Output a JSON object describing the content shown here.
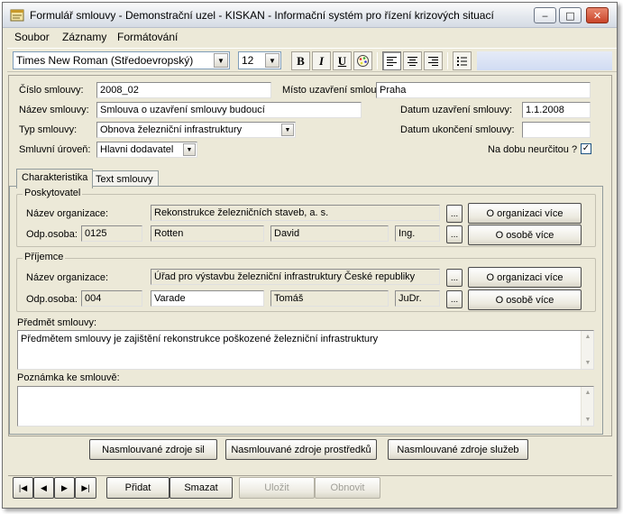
{
  "window": {
    "title": "Formulář smlouvy - Demonstrační uzel - KISKAN - Informační systém pro řízení krizových situací",
    "minimize_glyph": "‒",
    "maximize_glyph": "□",
    "close_glyph": "✕"
  },
  "menu": {
    "items": [
      "Soubor",
      "Záznamy",
      "Formátování"
    ]
  },
  "toolbar": {
    "font_name": "Times New Roman (Středoevropský)",
    "font_size": "12",
    "bold": "B",
    "italic": "I",
    "underline": "U",
    "dropdown_arrow": "▼"
  },
  "form": {
    "cislo_label": "Číslo smlouvy:",
    "cislo_value": "2008_02",
    "misto_label": "Místo uzavření smlouvy:",
    "misto_value": "Praha",
    "nazev_label": "Název smlouvy:",
    "nazev_value": "Smlouva o uzavření smlouvy budoucí",
    "datum_uzavreni_label": "Datum uzavření smlouvy:",
    "datum_uzavreni_value": "1.1.2008",
    "typ_label": "Typ smlouvy:",
    "typ_value": "Obnova železniční infrastruktury",
    "datum_ukonceni_label": "Datum ukončení smlouvy:",
    "datum_ukonceni_value": "",
    "uroven_label": "Smluvní úroveň:",
    "uroven_value": "Hlavni dodavatel",
    "neurcito_label": "Na dobu neurčitou ?",
    "neurcito_checked": "✓"
  },
  "tabs": {
    "charakteristika": "Charakteristika",
    "text": "Text smlouvy"
  },
  "poskytovatel": {
    "legend": "Poskytovatel",
    "org_label": "Název organizace:",
    "org_value": "Rekonstrukce železničních staveb, a. s.",
    "osoba_label": "Odp.osoba:",
    "osoba_id": "0125",
    "prijmeni": "Rotten",
    "jmeno": "David",
    "titul": "Ing.",
    "ellipsis": "...",
    "org_more": "O organizaci více",
    "osoba_more": "O osobě více"
  },
  "prijemce": {
    "legend": "Příjemce",
    "org_label": "Název organizace:",
    "org_value": "Úřad pro výstavbu železniční infrastruktury České republiky",
    "osoba_label": "Odp.osoba:",
    "osoba_id": "004",
    "prijmeni": "Varade",
    "jmeno": "Tomáš",
    "titul": "JuDr.",
    "ellipsis": "...",
    "org_more": "O organizaci více",
    "osoba_more": "O osobě více"
  },
  "predmet": {
    "label": "Předmět smlouvy:",
    "value": "Předmětem smlouvy je zajištění rekonstrukce poškozené železniční infrastruktury"
  },
  "poznamka": {
    "label": "Poznámka ke smlouvě:",
    "value": ""
  },
  "resources": {
    "sil": "Nasmlouvané zdroje sil",
    "prostredku": "Nasmlouvané zdroje prostředků",
    "sluzeb": "Nasmlouvané zdroje služeb"
  },
  "nav": {
    "first": "|◀",
    "prev": "◀",
    "next": "▶",
    "last": "▶|",
    "pridat": "Přidat",
    "smazat": "Smazat",
    "ulozit": "Uložit",
    "obnovit": "Obnovit"
  }
}
